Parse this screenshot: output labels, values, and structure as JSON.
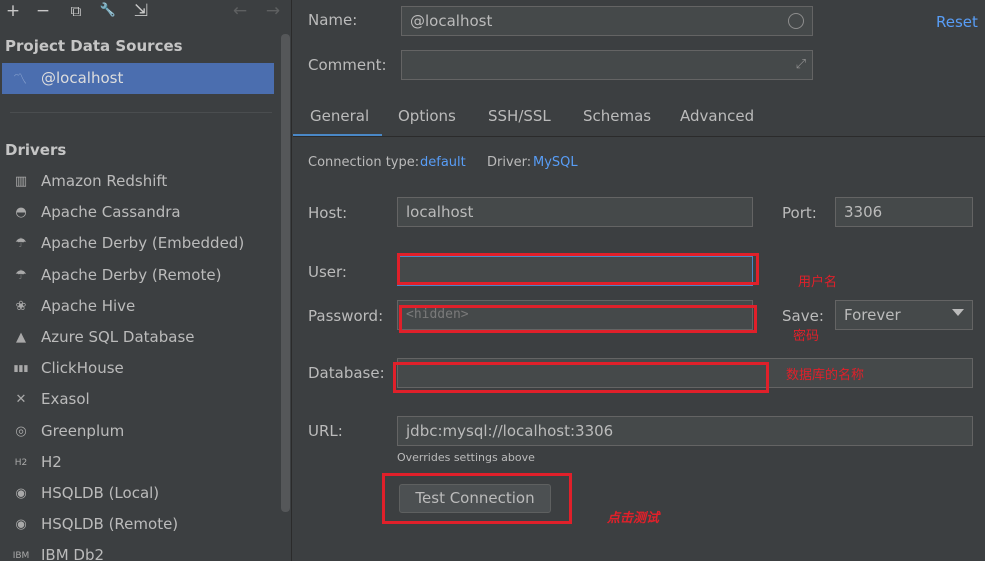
{
  "toolbar": {
    "add": "+",
    "remove": "−",
    "duplicate": "⧉",
    "settings": "🔧",
    "import": "⇲",
    "back": "←",
    "forward": "→"
  },
  "left": {
    "project_title": "Project Data Sources",
    "selected_source": "@localhost",
    "drivers_title": "Drivers",
    "drivers": [
      {
        "label": "Amazon Redshift",
        "icon": "▥"
      },
      {
        "label": "Apache Cassandra",
        "icon": "◓"
      },
      {
        "label": "Apache Derby (Embedded)",
        "icon": "☂"
      },
      {
        "label": "Apache Derby (Remote)",
        "icon": "☂"
      },
      {
        "label": "Apache Hive",
        "icon": "❀"
      },
      {
        "label": "Azure SQL Database",
        "icon": "▲"
      },
      {
        "label": "ClickHouse",
        "icon": "▮▮▮"
      },
      {
        "label": "Exasol",
        "icon": "✕"
      },
      {
        "label": "Greenplum",
        "icon": "◎"
      },
      {
        "label": "H2",
        "icon": "H2"
      },
      {
        "label": "HSQLDB (Local)",
        "icon": "◉"
      },
      {
        "label": "HSQLDB (Remote)",
        "icon": "◉"
      },
      {
        "label": "IBM Db2",
        "icon": "IBM"
      }
    ]
  },
  "form": {
    "name_label": "Name:",
    "name_value": "@localhost",
    "comment_label": "Comment:",
    "comment_value": "",
    "reset_label": "Reset",
    "tabs": [
      "General",
      "Options",
      "SSH/SSL",
      "Schemas",
      "Advanced"
    ],
    "conn_type_label": "Connection type:",
    "conn_type_value": "default",
    "driver_label": "Driver:",
    "driver_value": "MySQL",
    "host_label": "Host:",
    "host_value": "localhost",
    "port_label": "Port:",
    "port_value": "3306",
    "user_label": "User:",
    "user_value": "",
    "password_label": "Password:",
    "password_placeholder": "<hidden>",
    "save_label": "Save:",
    "save_value": "Forever",
    "database_label": "Database:",
    "database_value": "",
    "url_label": "URL:",
    "url_value": "jdbc:mysql://localhost:3306",
    "url_hint": "Overrides settings above",
    "test_button": "Test Connection"
  },
  "annotations": {
    "user_note": "用户名",
    "password_note": "密码",
    "database_note": "数据库的名称",
    "test_note": "点击测试"
  },
  "colors": {
    "accent": "#4b6eaf",
    "link": "#589df6",
    "annotation": "#e0202a"
  }
}
